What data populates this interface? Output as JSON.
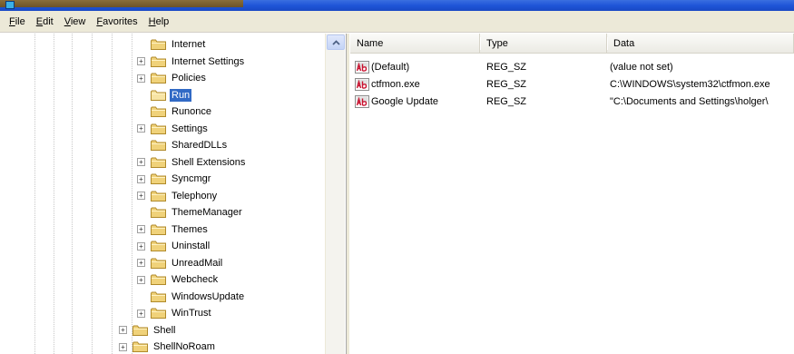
{
  "menu": [
    "File",
    "Edit",
    "View",
    "Favorites",
    "Help"
  ],
  "tree": {
    "items": [
      {
        "label": "Internet",
        "expander": "",
        "selected": false
      },
      {
        "label": "Internet Settings",
        "expander": "+",
        "selected": false
      },
      {
        "label": "Policies",
        "expander": "+",
        "selected": false
      },
      {
        "label": "Run",
        "expander": "",
        "selected": true
      },
      {
        "label": "Runonce",
        "expander": "",
        "selected": false
      },
      {
        "label": "Settings",
        "expander": "+",
        "selected": false
      },
      {
        "label": "SharedDLLs",
        "expander": "",
        "selected": false
      },
      {
        "label": "Shell Extensions",
        "expander": "+",
        "selected": false
      },
      {
        "label": "Syncmgr",
        "expander": "+",
        "selected": false
      },
      {
        "label": "Telephony",
        "expander": "+",
        "selected": false
      },
      {
        "label": "ThemeManager",
        "expander": "",
        "selected": false
      },
      {
        "label": "Themes",
        "expander": "+",
        "selected": false
      },
      {
        "label": "Uninstall",
        "expander": "+",
        "selected": false
      },
      {
        "label": "UnreadMail",
        "expander": "+",
        "selected": false
      },
      {
        "label": "Webcheck",
        "expander": "+",
        "selected": false
      },
      {
        "label": "WindowsUpdate",
        "expander": "",
        "selected": false
      },
      {
        "label": "WinTrust",
        "expander": "+",
        "selected": false
      }
    ],
    "parent_items": [
      {
        "label": "Shell",
        "expander": "+"
      },
      {
        "label": "ShellNoRoam",
        "expander": "+"
      }
    ]
  },
  "list": {
    "columns": [
      "Name",
      "Type",
      "Data"
    ],
    "rows": [
      {
        "name": "(Default)",
        "type": "REG_SZ",
        "data": "(value not set)"
      },
      {
        "name": "ctfmon.exe",
        "type": "REG_SZ",
        "data": "C:\\WINDOWS\\system32\\ctfmon.exe"
      },
      {
        "name": "Google Update",
        "type": "REG_SZ",
        "data": "\"C:\\Documents and Settings\\holger\\"
      }
    ]
  },
  "colors": {
    "selection": "#316ac5",
    "folder": "#f0d27a",
    "titlebar": "#1f55d8"
  }
}
